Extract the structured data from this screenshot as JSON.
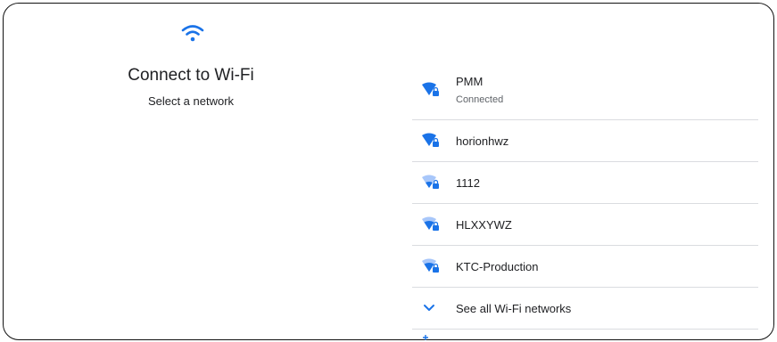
{
  "header": {
    "icon": "wifi-icon",
    "title": "Connect to Wi-Fi",
    "subtitle": "Select a network"
  },
  "colors": {
    "accent": "#1a73e8",
    "signal_dim": "#a8c7fa",
    "text": "#202124",
    "secondary_text": "#5f6368",
    "divider": "#dadce0"
  },
  "networks": [
    {
      "name": "PMM",
      "status": "Connected",
      "signal": "full",
      "secured": true,
      "icon": "wifi-lock-icon"
    },
    {
      "name": "horionhwz",
      "status": "",
      "signal": "full",
      "secured": true,
      "icon": "wifi-lock-icon"
    },
    {
      "name": "1112",
      "status": "",
      "signal": "weak",
      "secured": true,
      "icon": "wifi-lock-icon"
    },
    {
      "name": "HLXXYWZ",
      "status": "",
      "signal": "medium",
      "secured": true,
      "icon": "wifi-lock-icon"
    },
    {
      "name": "KTC-Production",
      "status": "",
      "signal": "medium",
      "secured": true,
      "icon": "wifi-lock-icon"
    }
  ],
  "see_all": {
    "label": "See all Wi-Fi networks",
    "icon": "chevron-down-icon"
  }
}
